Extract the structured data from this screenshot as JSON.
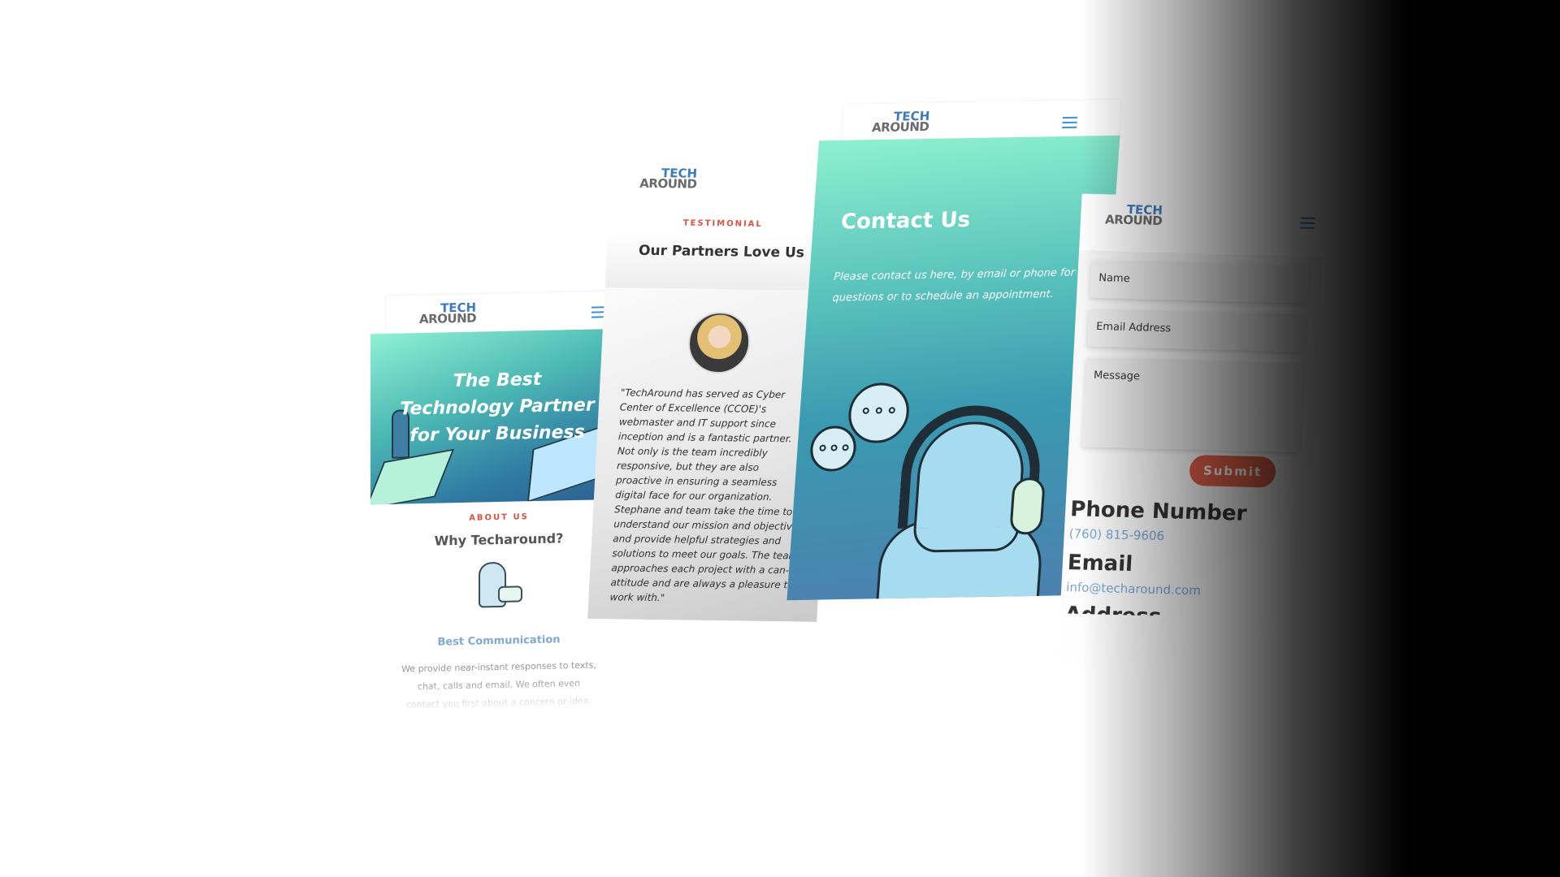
{
  "brand": {
    "logo_line1": "TECH",
    "logo_line2": "AROUND"
  },
  "home": {
    "hero_title": "The Best Technology Partner for Your Business",
    "eyebrow": "ABOUT US",
    "heading": "Why Techaround?",
    "feature_title": "Best Communication",
    "feature_text": "We provide near-instant responses to texts, chat, calls and email. We often even contact you first about a concern or idea. We are local"
  },
  "testimonial": {
    "eyebrow": "TESTIMONIAL",
    "heading": "Our Partners Love Us",
    "quote": "\"TechAround has served as Cyber Center of Excellence (CCOE)'s webmaster and IT support since inception and is a fantastic partner. Not only is the team incredibly responsive, but they are also proactive in ensuring a seamless digital face for our organization. Stephane and team take the time to understand our mission and objectives and provide helpful strategies and solutions to meet our goals. The team approaches each project with a can-do attitude and are always a pleasure to work with.\""
  },
  "contact": {
    "heading": "Contact Us",
    "lead": "Please contact us here, by email or phone for questions or to schedule an appointment."
  },
  "form": {
    "name_placeholder": "Name",
    "email_placeholder": "Email Address",
    "message_placeholder": "Message",
    "submit_label": "Submit",
    "phone_label": "Phone Number",
    "phone_value": "(760) 815-9606",
    "email_label": "Email",
    "email_value": "info@techaround.com",
    "address_label": "Address"
  },
  "colors": {
    "brand_blue": "#3d7bbf",
    "accent_red": "#e0523e",
    "teal_light": "#8ff0d3",
    "teal_dark": "#2d5e8f"
  }
}
